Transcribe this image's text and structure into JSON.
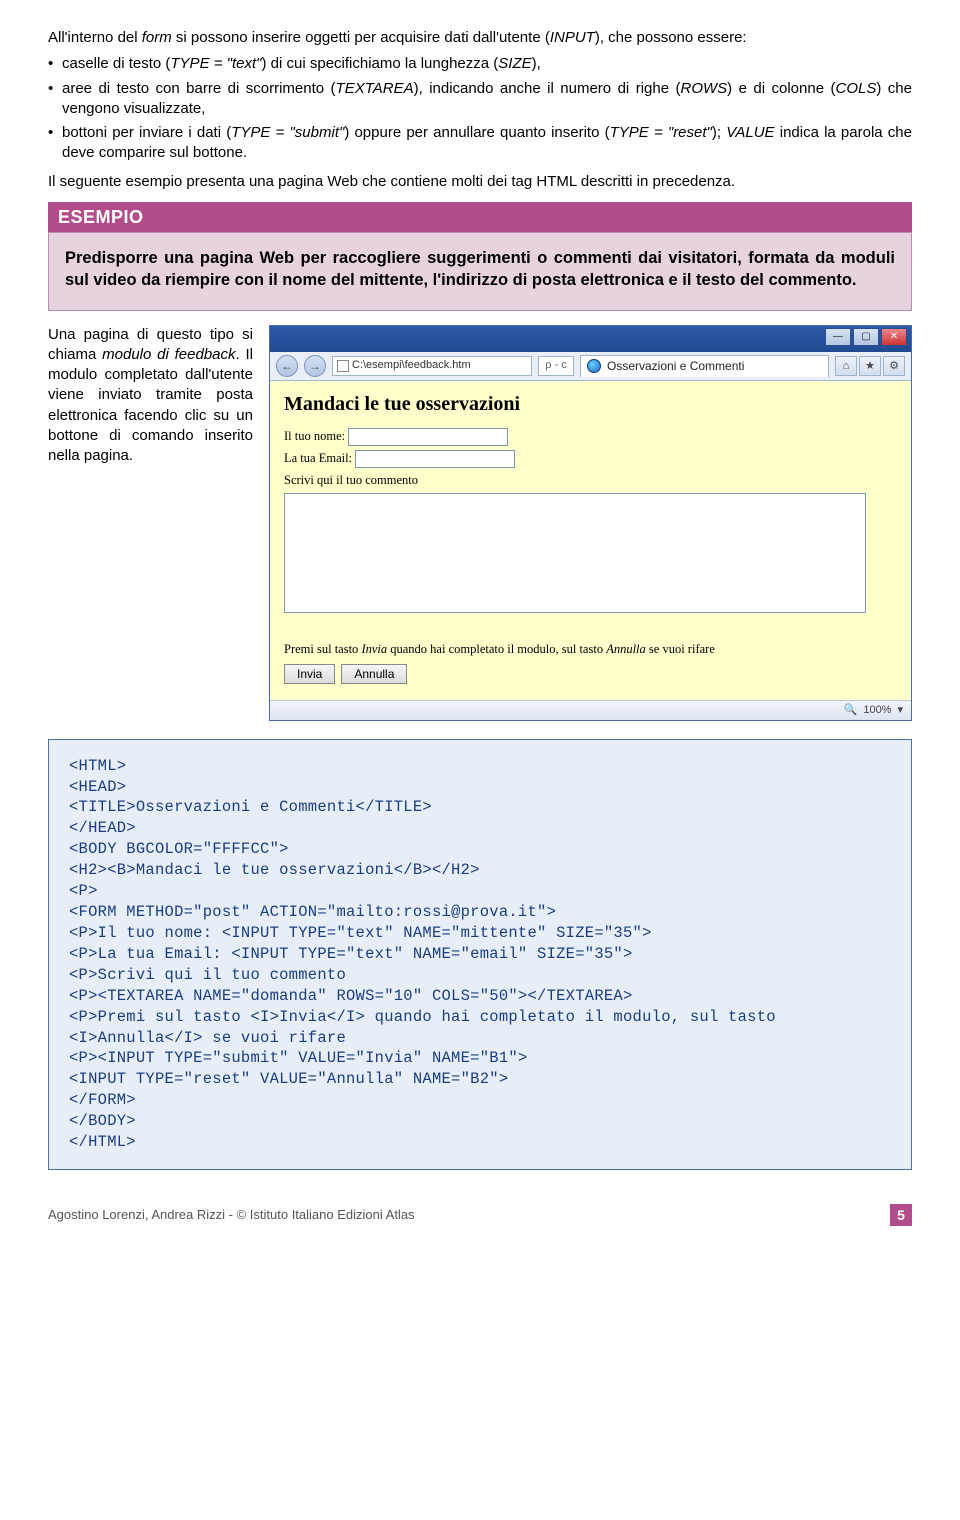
{
  "intro": {
    "lead": "All'interno del form si possono inserire oggetti per acquisire dati dall'utente (INPUT), che possono essere:",
    "bullets": [
      "caselle di testo (TYPE = \"text\") di cui specifichiamo la lunghezza (SIZE),",
      "aree di testo con barre di scorrimento (TEXTAREA), indicando anche il numero di righe (ROWS) e di colonne (COLS) che vengono visualizzate,",
      "bottoni per inviare i dati (TYPE = \"submit\") oppure per annullare quanto inserito (TYPE = \"reset\"); VALUE indica la parola che deve comparire sul bottone."
    ],
    "after": "Il seguente esempio presenta una pagina Web che contiene molti dei tag HTML descritti in precedenza."
  },
  "esempio": {
    "title": "ESEMPIO",
    "text": "Predisporre una pagina Web per raccogliere suggerimenti o commenti dai visitatori, formata da moduli sul video da riempire con il nome del mittente, l'indirizzo di posta elettronica e il testo del commento."
  },
  "leftcol": {
    "p1a": "Una pagina di questo tipo si chiama ",
    "p1b": "modulo di feedback",
    "p1c": ". Il modulo completato dall'utente viene inviato tramite posta elettronica facendo clic su un bottone di comando inserito nella pagina."
  },
  "browser": {
    "winbtns": {
      "min": "—",
      "max": "▢",
      "close": "✕"
    },
    "nav": {
      "back": "←",
      "fwd": "→"
    },
    "address": "C:\\esempi\\feedback.htm",
    "search_placeholder": "ρ - c",
    "tab_title": "Osservazioni e Commenti",
    "tool": {
      "home": "⌂",
      "star": "★",
      "gear": "⚙"
    },
    "page": {
      "heading": "Mandaci le tue osservazioni",
      "label_name": "Il tuo nome:",
      "label_email": "La tua Email:",
      "label_comment": "Scrivi qui il tuo commento",
      "note_a": "Premi sul tasto ",
      "note_b": "Invia",
      "note_c": " quando hai completato il modulo, sul tasto ",
      "note_d": "Annulla",
      "note_e": " se vuoi rifare",
      "btn_submit": "Invia",
      "btn_reset": "Annulla"
    },
    "status": {
      "zoom_icon": "🔍",
      "zoom": "100%",
      "arrow": "▾"
    }
  },
  "code": "<HTML>\n<HEAD>\n<TITLE>Osservazioni e Commenti</TITLE>\n</HEAD>\n<BODY BGCOLOR=\"FFFFCC\">\n<H2><B>Mandaci le tue osservazioni</B></H2>\n<P>\n<FORM METHOD=\"post\" ACTION=\"mailto:rossi@prova.it\">\n<P>Il tuo nome: <INPUT TYPE=\"text\" NAME=\"mittente\" SIZE=\"35\">\n<P>La tua Email: <INPUT TYPE=\"text\" NAME=\"email\" SIZE=\"35\">\n<P>Scrivi qui il tuo commento\n<P><TEXTAREA NAME=\"domanda\" ROWS=\"10\" COLS=\"50\"></TEXTAREA>\n<P>Premi sul tasto <I>Invia</I> quando hai completato il modulo, sul tasto\n<I>Annulla</I> se vuoi rifare\n<P><INPUT TYPE=\"submit\" VALUE=\"Invia\" NAME=\"B1\">\n<INPUT TYPE=\"reset\" VALUE=\"Annulla\" NAME=\"B2\">\n</FORM>\n</BODY>\n</HTML>",
  "footer": {
    "credit": "Agostino Lorenzi, Andrea Rizzi - © Istituto Italiano Edizioni Atlas",
    "page": "5"
  }
}
